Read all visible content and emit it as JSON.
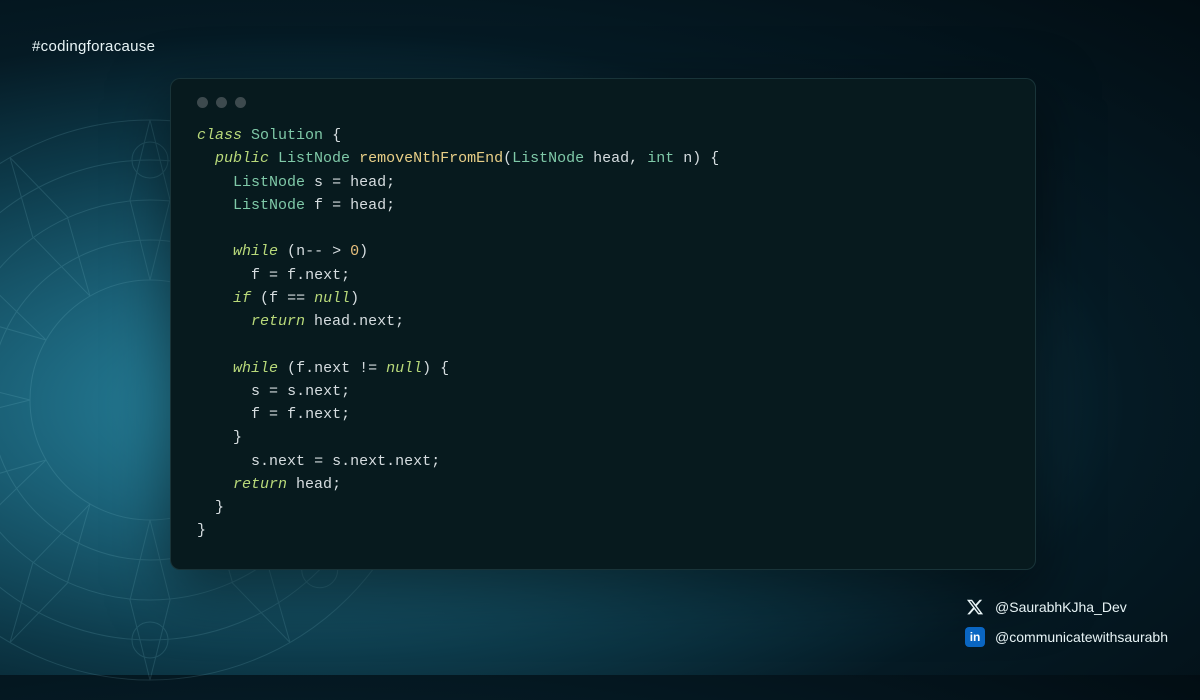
{
  "hashtag": "#codingforacause",
  "code": {
    "class_kw": "class",
    "class_name": "Solution",
    "public_kw": "public",
    "ret_type": "ListNode",
    "fn_name": "removeNthFromEnd",
    "param1_type": "ListNode",
    "param1_name": "head",
    "param2_type": "int",
    "param2_name": "n",
    "decl_type": "ListNode",
    "var_s": "s",
    "var_f": "f",
    "head": "head",
    "while_kw": "while",
    "if_kw": "if",
    "return_kw": "return",
    "null_kw": "null",
    "next": "next",
    "zero": "0"
  },
  "socials": {
    "twitter": "@SaurabhKJha_Dev",
    "linkedin": "@communicatewithsaurabh"
  }
}
